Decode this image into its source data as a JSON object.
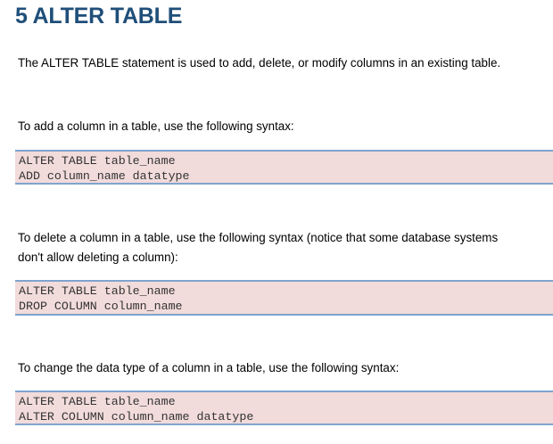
{
  "section": {
    "heading": "5 ALTER TABLE",
    "intro": "The ALTER TABLE statement is used to add, delete, or modify columns in an existing table."
  },
  "add_column": {
    "text": "To add a column in a table, use the following syntax:",
    "code": [
      "ALTER TABLE table_name",
      "ADD column_name datatype"
    ]
  },
  "drop_column": {
    "text_line1": "To delete a column in a table, use the following syntax (notice that some database systems",
    "text_line2": "don't allow deleting a column):",
    "code": [
      "ALTER TABLE table_name",
      "DROP COLUMN column_name"
    ]
  },
  "alter_column": {
    "text": "To change the data type of a column in a table, use the following syntax:",
    "code": [
      "ALTER TABLE table_name",
      "ALTER COLUMN column_name datatype"
    ]
  },
  "colors": {
    "heading": "#1f4e79",
    "code_background": "#f2dbdb",
    "code_border": "#7fa4cf"
  }
}
